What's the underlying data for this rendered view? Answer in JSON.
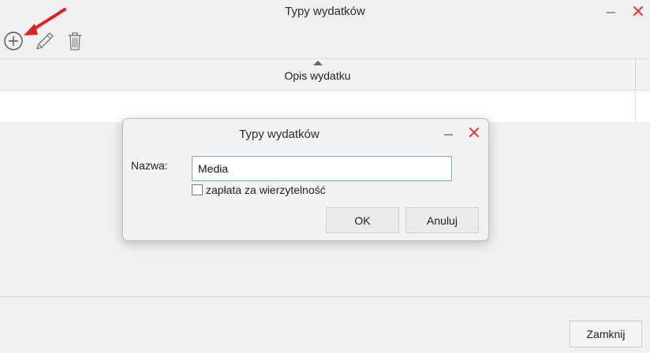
{
  "window": {
    "title": "Typy wydatków"
  },
  "toolbar": {
    "add_icon": "plus-circle-icon",
    "edit_icon": "pencil-icon",
    "delete_icon": "trash-icon"
  },
  "table": {
    "columns": [
      "Opis wydatku"
    ],
    "sort_direction": "ascending",
    "rows": [
      [
        ""
      ]
    ]
  },
  "footer": {
    "close_label": "Zamknij"
  },
  "dialog": {
    "title": "Typy wydatków",
    "name_label": "Nazwa:",
    "name_value": "Media",
    "checkbox_label": "zapłata za wierzytelność",
    "checkbox_checked": false,
    "ok_label": "OK",
    "cancel_label": "Anuluj"
  },
  "colors": {
    "close_x": "#e53935",
    "arrow": "#e02020",
    "input_border": "#7aa7d6"
  }
}
